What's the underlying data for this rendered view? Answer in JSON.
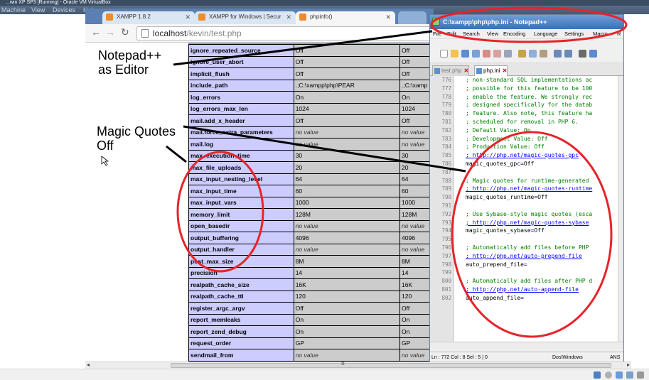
{
  "vm": {
    "title": "...win XP SP3 [Running] - Oracle VM VirtualBox",
    "menu": [
      "Machine",
      "View",
      "Devices",
      "Help"
    ]
  },
  "browser": {
    "tabs": [
      {
        "label": "XAMPP 1.8.2",
        "active": false
      },
      {
        "label": "XAMPP for Windows | Secur",
        "active": false
      },
      {
        "label": "phpinfo()",
        "active": true
      }
    ],
    "url_host": "localhost",
    "url_path": "/kevin/test.php"
  },
  "php_table": [
    {
      "name": "ignore_repeated_source",
      "local": "Off",
      "master": "Off"
    },
    {
      "name": "ignore_user_abort",
      "local": "Off",
      "master": "Off"
    },
    {
      "name": "implicit_flush",
      "local": "Off",
      "master": "Off"
    },
    {
      "name": "include_path",
      "local": ".;C:\\xampp\\php\\PEAR",
      "master": ".;C:\\xamp"
    },
    {
      "name": "log_errors",
      "local": "On",
      "master": "On"
    },
    {
      "name": "log_errors_max_len",
      "local": "1024",
      "master": "1024"
    },
    {
      "name": "mail.add_x_header",
      "local": "Off",
      "master": "Off"
    },
    {
      "name": "mail.force_extra_parameters",
      "local": "no value",
      "master": "no value",
      "no_value": true
    },
    {
      "name": "mail.log",
      "local": "no value",
      "master": "no value",
      "no_value": true
    },
    {
      "name": "max_execution_time",
      "local": "30",
      "master": "30"
    },
    {
      "name": "max_file_uploads",
      "local": "20",
      "master": "20"
    },
    {
      "name": "max_input_nesting_level",
      "local": "64",
      "master": "64"
    },
    {
      "name": "max_input_time",
      "local": "60",
      "master": "60"
    },
    {
      "name": "max_input_vars",
      "local": "1000",
      "master": "1000"
    },
    {
      "name": "memory_limit",
      "local": "128M",
      "master": "128M"
    },
    {
      "name": "open_basedir",
      "local": "no value",
      "master": "no value",
      "no_value": true
    },
    {
      "name": "output_buffering",
      "local": "4096",
      "master": "4096"
    },
    {
      "name": "output_handler",
      "local": "no value",
      "master": "no value",
      "no_value": true
    },
    {
      "name": "post_max_size",
      "local": "8M",
      "master": "8M"
    },
    {
      "name": "precision",
      "local": "14",
      "master": "14"
    },
    {
      "name": "realpath_cache_size",
      "local": "16K",
      "master": "16K"
    },
    {
      "name": "realpath_cache_ttl",
      "local": "120",
      "master": "120"
    },
    {
      "name": "register_argc_argv",
      "local": "Off",
      "master": "Off"
    },
    {
      "name": "report_memleaks",
      "local": "On",
      "master": "On"
    },
    {
      "name": "report_zend_debug",
      "local": "On",
      "master": "On"
    },
    {
      "name": "request_order",
      "local": "GP",
      "master": "GP"
    },
    {
      "name": "sendmail_from",
      "local": "no value",
      "master": "no value",
      "no_value": true
    }
  ],
  "notepad": {
    "title": "C:\\xampp\\php\\php.ini - Notepad++",
    "menu": [
      "File",
      "Edit",
      "Search",
      "View",
      "Encoding",
      "Language",
      "Settings",
      "Macro",
      "R"
    ],
    "tabs": [
      {
        "label": "test.php",
        "active": false
      },
      {
        "label": "php.ini",
        "active": true
      }
    ],
    "lines": [
      {
        "n": "776",
        "t": "; non-standard SQL implementations ac",
        "s": "cm"
      },
      {
        "n": "777",
        "t": "; possible for this feature to be 100",
        "s": "cm"
      },
      {
        "n": "778",
        "t": "; enable the feature. We strongly rec",
        "s": "cm"
      },
      {
        "n": "779",
        "t": "; designed specifically for the datab",
        "s": "cm"
      },
      {
        "n": "780",
        "t": "; feature. Also note, this feature ha",
        "s": "cm"
      },
      {
        "n": "781",
        "t": "; scheduled for removal in PHP 6.",
        "s": "cm"
      },
      {
        "n": "782",
        "t": "; Default Value: On",
        "s": "cm"
      },
      {
        "n": "783",
        "t": "; Development Value: Off",
        "s": "cm"
      },
      {
        "n": "784",
        "t": "; Production Value: Off",
        "s": "cm"
      },
      {
        "n": "785",
        "t": "; http://php.net/magic-quotes-gpc",
        "s": "lk"
      },
      {
        "n": "786",
        "t": "magic_quotes_gpc=Off",
        "s": "kv"
      },
      {
        "n": "787",
        "t": "",
        "s": "cm"
      },
      {
        "n": "788",
        "t": "; Magic quotes for runtime-generated",
        "s": "cm"
      },
      {
        "n": "789",
        "t": "; http://php.net/magic-quotes-runtime",
        "s": "lk"
      },
      {
        "n": "790",
        "t": "magic_quotes_runtime=Off",
        "s": "kv"
      },
      {
        "n": "791",
        "t": "",
        "s": "cm"
      },
      {
        "n": "792",
        "t": "; Use Sybase-style magic quotes (esca",
        "s": "cm"
      },
      {
        "n": "793",
        "t": "; http://php.net/magic-quotes-sybase",
        "s": "lk"
      },
      {
        "n": "794",
        "t": "magic_quotes_sybase=Off",
        "s": "kv"
      },
      {
        "n": "795",
        "t": "",
        "s": "cm"
      },
      {
        "n": "796",
        "t": "; Automatically add files before PHP",
        "s": "cm"
      },
      {
        "n": "797",
        "t": "; http://php.net/auto-prepend-file",
        "s": "lk"
      },
      {
        "n": "798",
        "t": "auto_prepend_file=",
        "s": "kv"
      },
      {
        "n": "799",
        "t": "",
        "s": "cm"
      },
      {
        "n": "800",
        "t": "; Automatically add files after PHP d",
        "s": "cm"
      },
      {
        "n": "801",
        "t": "; http://php.net/auto-append-file",
        "s": "lk"
      },
      {
        "n": "802",
        "t": "auto_append_file=",
        "s": "kv"
      }
    ],
    "status": {
      "pos": "Ln : 772   Col : 8   Sel : 5 | 0",
      "eol": "Dos\\Windows",
      "enc": "ANS"
    }
  },
  "annotations": {
    "editor_label": "Notepad++\nas Editor",
    "magic_label": "Magic Quotes\n Off",
    "ann_color": "#e8232a"
  }
}
